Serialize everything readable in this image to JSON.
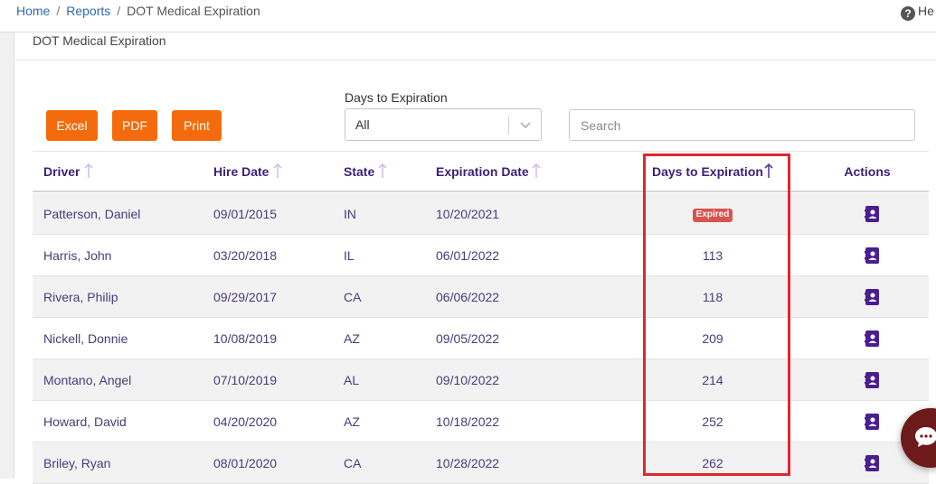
{
  "breadcrumb": {
    "home": "Home",
    "reports": "Reports",
    "current": "DOT Medical Expiration"
  },
  "help": {
    "label": "He"
  },
  "panel": {
    "title": "DOT Medical Expiration"
  },
  "toolbar": {
    "excel": "Excel",
    "pdf": "PDF",
    "print": "Print",
    "filter_label": "Days to Expiration",
    "filter_value": "All",
    "search_placeholder": "Search"
  },
  "table": {
    "headers": {
      "driver": "Driver",
      "hire_date": "Hire Date",
      "state": "State",
      "expiration_date": "Expiration Date",
      "days_to_expiration": "Days to Expiration",
      "actions": "Actions"
    },
    "rows": [
      {
        "driver": "Patterson, Daniel",
        "hire_date": "09/01/2015",
        "state": "IN",
        "expiration_date": "10/20/2021",
        "days": "",
        "badge": "Expired"
      },
      {
        "driver": "Harris, John",
        "hire_date": "03/20/2018",
        "state": "IL",
        "expiration_date": "06/01/2022",
        "days": "113"
      },
      {
        "driver": "Rivera, Philip",
        "hire_date": "09/29/2017",
        "state": "CA",
        "expiration_date": "06/06/2022",
        "days": "118"
      },
      {
        "driver": "Nickell, Donnie",
        "hire_date": "10/08/2019",
        "state": "AZ",
        "expiration_date": "09/05/2022",
        "days": "209"
      },
      {
        "driver": "Montano, Angel",
        "hire_date": "07/10/2019",
        "state": "AL",
        "expiration_date": "09/10/2022",
        "days": "214"
      },
      {
        "driver": "Howard, David",
        "hire_date": "04/20/2020",
        "state": "AZ",
        "expiration_date": "10/18/2022",
        "days": "252"
      },
      {
        "driver": "Briley, Ryan",
        "hire_date": "08/01/2020",
        "state": "CA",
        "expiration_date": "10/28/2022",
        "days": "262"
      }
    ]
  },
  "icons": {
    "help": "question-circle-icon",
    "dropdown": "chevron-down-icon",
    "sort": "sort-arrow-up-icon",
    "action": "contact-card-icon",
    "chat": "chat-bubble-icon"
  },
  "colors": {
    "accent": "#f46b0d",
    "header_text": "#3b1f78",
    "action_icon": "#4b1d8f",
    "badge": "#d9534f",
    "highlight": "#e0262e",
    "link": "#2b6cb0",
    "chat": "#6d1a1a"
  }
}
